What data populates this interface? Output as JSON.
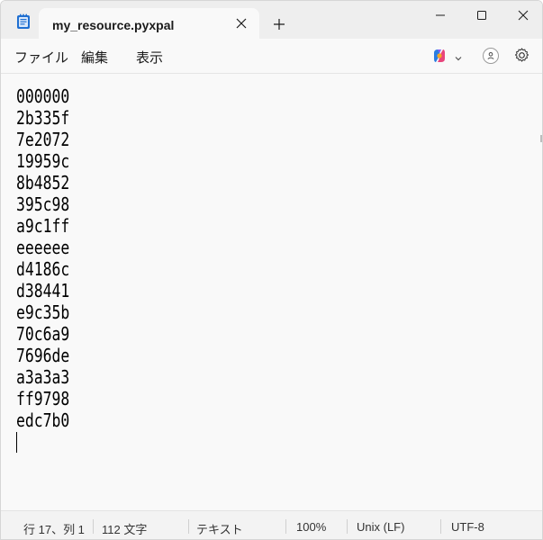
{
  "window": {
    "tab_title": "my_resource.pyxpal",
    "new_tab_glyph": "+"
  },
  "menu": {
    "file": "ファイル",
    "edit": "編集",
    "view": "表示"
  },
  "toolbar": {
    "copilot_icon": "copilot-icon",
    "profile_icon": "avatar-icon",
    "settings_icon": "gear-icon"
  },
  "editor": {
    "lines": [
      "000000",
      "2b335f",
      "7e2072",
      "19959c",
      "8b4852",
      "395c98",
      "a9c1ff",
      "eeeeee",
      "d4186c",
      "d38441",
      "e9c35b",
      "70c6a9",
      "7696de",
      "a3a3a3",
      "ff9798",
      "edc7b0"
    ]
  },
  "status": {
    "position": "行 17、列 1",
    "char_count": "112 文字",
    "format": "テキスト",
    "zoom": "100%",
    "line_ending": "Unix (LF)",
    "encoding": "UTF-8"
  },
  "colors": {
    "titlebar_bg": "#eeeeee",
    "content_bg": "#f9f9f9",
    "statusbar_bg": "#f3f3f3",
    "notepad_icon": "#1f6fd1"
  }
}
